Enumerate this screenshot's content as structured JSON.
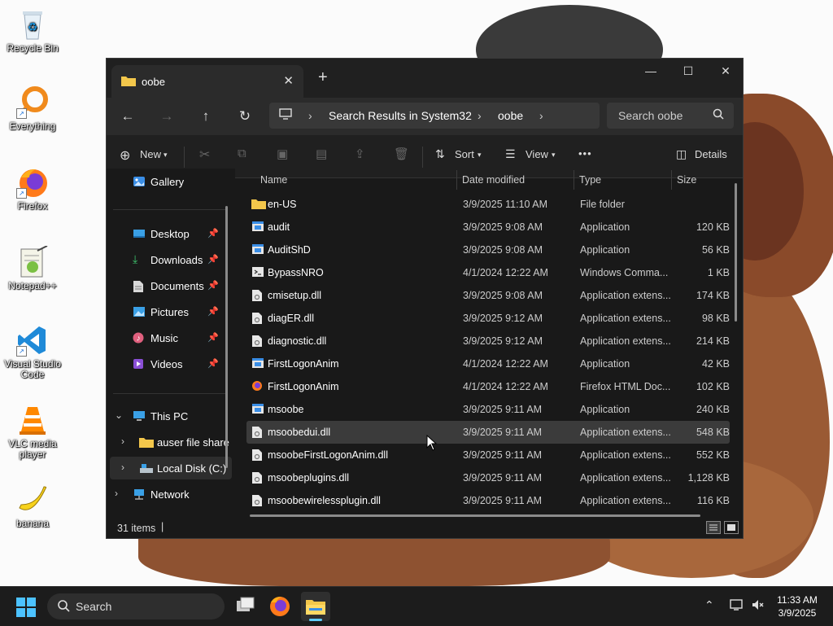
{
  "desktop": {
    "icons": [
      {
        "label": "Recycle Bin"
      },
      {
        "label": "Everything"
      },
      {
        "label": "Firefox"
      },
      {
        "label": "Notepad++"
      },
      {
        "label": "Visual Studio Code"
      },
      {
        "label": "VLC media player"
      },
      {
        "label": "banana"
      }
    ]
  },
  "window": {
    "tab_title": "oobe",
    "new_tab": "+",
    "controls": {
      "minimize": "—",
      "maximize": "☐",
      "close": "✕"
    },
    "address": {
      "segment1": "Search Results in System32",
      "segment2": "oobe"
    },
    "search_placeholder": "Search oobe",
    "toolbar": {
      "new_label": "New",
      "sort_label": "Sort",
      "view_label": "View",
      "more_label": "•••",
      "details_label": "Details"
    },
    "nav": {
      "gallery": "Gallery",
      "quick_access": [
        {
          "label": "Desktop"
        },
        {
          "label": "Downloads"
        },
        {
          "label": "Documents"
        },
        {
          "label": "Pictures"
        },
        {
          "label": "Music"
        },
        {
          "label": "Videos"
        }
      ],
      "this_pc": "This PC",
      "auser": "auser file share",
      "local_disk": "Local Disk (C:)",
      "network": "Network"
    },
    "columns": {
      "name": "Name",
      "date": "Date modified",
      "type": "Type",
      "size": "Size"
    },
    "files": [
      {
        "name": "en-US",
        "date": "3/9/2025 11:10 AM",
        "type": "File folder",
        "size": "",
        "icon": "folder-icon"
      },
      {
        "name": "audit",
        "date": "3/9/2025 9:08 AM",
        "type": "Application",
        "size": "120 KB",
        "icon": "app-icon"
      },
      {
        "name": "AuditShD",
        "date": "3/9/2025 9:08 AM",
        "type": "Application",
        "size": "56 KB",
        "icon": "app-icon"
      },
      {
        "name": "BypassNRO",
        "date": "4/1/2024 12:22 AM",
        "type": "Windows Comma...",
        "size": "1 KB",
        "icon": "cmd-icon"
      },
      {
        "name": "cmisetup.dll",
        "date": "3/9/2025 9:08 AM",
        "type": "Application extens...",
        "size": "174 KB",
        "icon": "dll-icon"
      },
      {
        "name": "diagER.dll",
        "date": "3/9/2025 9:12 AM",
        "type": "Application extens...",
        "size": "98 KB",
        "icon": "dll-icon"
      },
      {
        "name": "diagnostic.dll",
        "date": "3/9/2025 9:12 AM",
        "type": "Application extens...",
        "size": "214 KB",
        "icon": "dll-icon"
      },
      {
        "name": "FirstLogonAnim",
        "date": "4/1/2024 12:22 AM",
        "type": "Application",
        "size": "42 KB",
        "icon": "app-icon"
      },
      {
        "name": "FirstLogonAnim",
        "date": "4/1/2024 12:22 AM",
        "type": "Firefox HTML Doc...",
        "size": "102 KB",
        "icon": "firefox-doc-icon"
      },
      {
        "name": "msoobe",
        "date": "3/9/2025 9:11 AM",
        "type": "Application",
        "size": "240 KB",
        "icon": "app-icon"
      },
      {
        "name": "msoobedui.dll",
        "date": "3/9/2025 9:11 AM",
        "type": "Application extens...",
        "size": "548 KB",
        "icon": "dll-icon"
      },
      {
        "name": "msoobeFirstLogonAnim.dll",
        "date": "3/9/2025 9:11 AM",
        "type": "Application extens...",
        "size": "552 KB",
        "icon": "dll-icon"
      },
      {
        "name": "msoobeplugins.dll",
        "date": "3/9/2025 9:11 AM",
        "type": "Application extens...",
        "size": "1,128 KB",
        "icon": "dll-icon"
      },
      {
        "name": "msoobewirelessplugin.dll",
        "date": "3/9/2025 9:11 AM",
        "type": "Application extens...",
        "size": "116 KB",
        "icon": "dll-icon"
      }
    ],
    "status": {
      "item_count": "31 items",
      "cursor": "|"
    }
  },
  "taskbar": {
    "search_placeholder": "Search",
    "time": "11:33 AM",
    "date": "3/9/2025"
  },
  "colors": {
    "accent": "#60cdff",
    "folder": "#f3c74b",
    "window_bg": "#191919",
    "selection": "#3b3b3b"
  }
}
